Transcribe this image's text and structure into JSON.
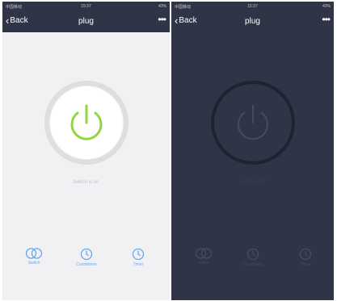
{
  "screens": [
    {
      "status": {
        "carrier": "中国移动",
        "time": "15:37",
        "battery": "43%"
      },
      "nav": {
        "back_label": "Back",
        "title": "plug",
        "more_label": "•••"
      },
      "state_text": "Switch is on",
      "actions": [
        "Switch",
        "Countdown",
        "Timer"
      ]
    },
    {
      "status": {
        "carrier": "中国移动",
        "time": "15:37",
        "battery": "43%"
      },
      "nav": {
        "back_label": "Back",
        "title": "plug",
        "more_label": "•••"
      },
      "state_text": "Switch is off",
      "actions": [
        "Switch",
        "Countdown",
        "Timer"
      ]
    }
  ],
  "colors": {
    "nav_bg": "#2f3446",
    "on_accent": "#8fd63f",
    "action_blue": "#6aa6ee",
    "dark_bg": "#2f3446"
  },
  "icons": {
    "power": "power-icon",
    "switch": "toggle-circles-icon",
    "countdown": "countdown-clock-icon",
    "timer": "timer-clock-icon"
  }
}
